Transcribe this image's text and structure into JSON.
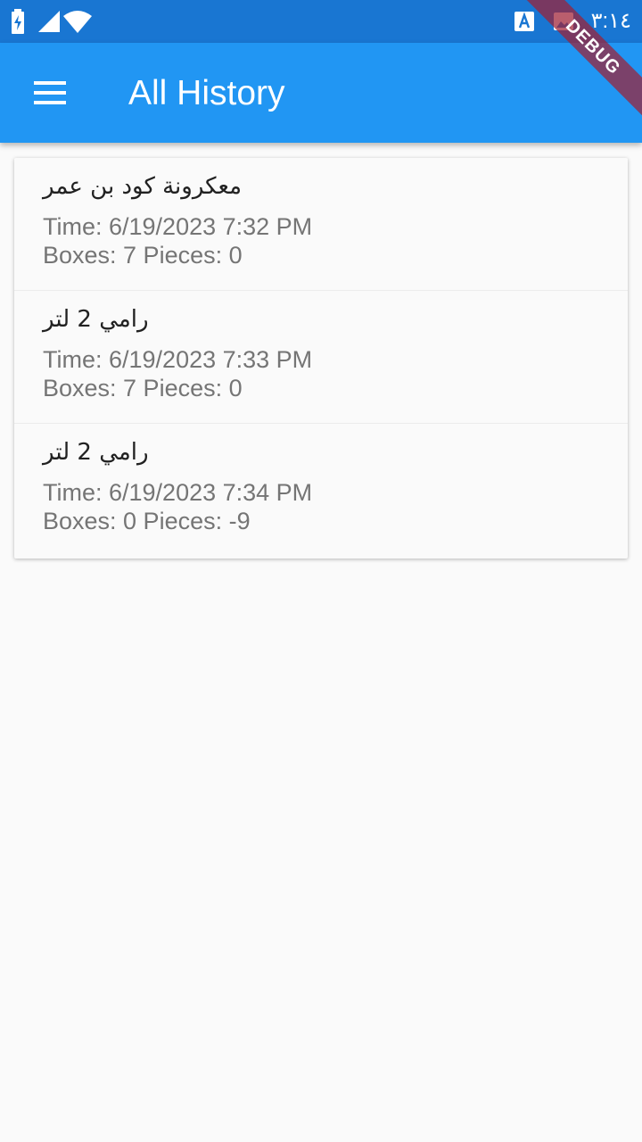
{
  "status_bar": {
    "clock": "٣:١٤",
    "icons": [
      "battery-charging-icon",
      "signal-icon",
      "wifi-icon",
      "keyboard-a-icon",
      "image-icon"
    ]
  },
  "app_bar": {
    "title": "All History",
    "menu_icon": "hamburger-menu-icon"
  },
  "debug_banner": {
    "label": "DEBUG"
  },
  "history": [
    {
      "name": "معكرونة كود بن عمر",
      "time": "Time: 6/19/2023 7:32 PM",
      "qty": "Boxes: 7 Pieces: 0"
    },
    {
      "name": "رامي 2 لتر",
      "time": "Time: 6/19/2023 7:33 PM",
      "qty": "Boxes: 7 Pieces: 0"
    },
    {
      "name": "رامي 2 لتر",
      "time": "Time: 6/19/2023 7:34 PM",
      "qty": "Boxes: 0 Pieces: -9"
    }
  ],
  "colors": {
    "status_bar": "#1976d2",
    "app_bar": "#2196f3",
    "background": "#fafafa",
    "primary_text": "#212121",
    "secondary_text": "#757575",
    "debug_ribbon": "#9e2034"
  }
}
